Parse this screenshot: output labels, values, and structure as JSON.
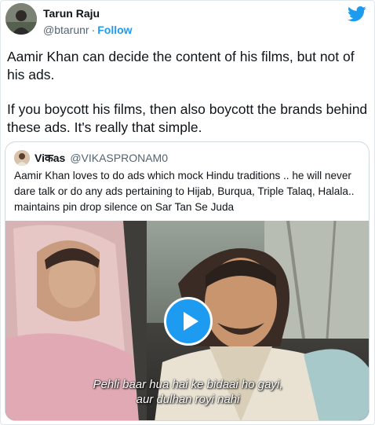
{
  "author": {
    "name": "Tarun Raju",
    "handle": "@btarunr",
    "separator": "·",
    "follow_label": "Follow"
  },
  "brand_icon": "twitter-bird-icon",
  "tweet": {
    "paragraph_1": "Aamir Khan can decide the content of his films, but not of his ads.",
    "paragraph_2": "If you boycott his films, then also boycott the brands behind these ads. It's really that simple."
  },
  "quoted": {
    "name": "Viकas",
    "handle": "@VIKASPRONAM0",
    "text": "Aamir Khan loves to do ads which mock Hindu traditions .. he will never dare talk or do any ads pertaining to Hijab, Burqua, Triple Talaq, Halala.. maintains pin drop silence on Sar Tan Se Juda",
    "video": {
      "play_icon": "play-icon",
      "subtitle_line_1": "Pehli baar hua hai ke bidaai ho gayi,",
      "subtitle_line_2": "aur dulhan royi nahi"
    }
  },
  "colors": {
    "accent": "#1d9bf0",
    "text": "#0f1419",
    "muted": "#536471",
    "border": "#cfd9de"
  }
}
